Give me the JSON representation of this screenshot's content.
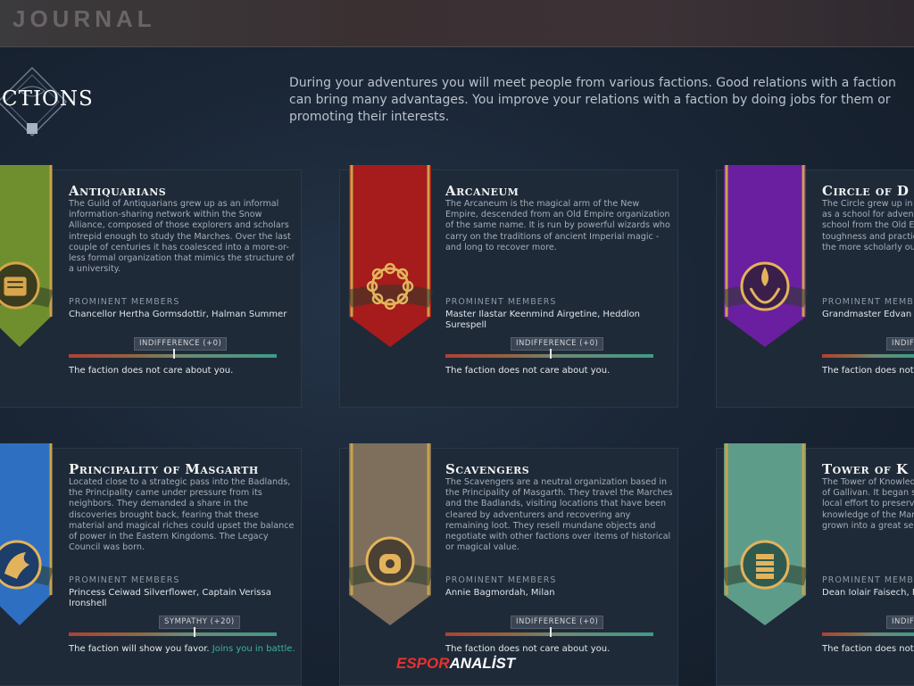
{
  "header": {
    "title": "JOURNAL"
  },
  "section": {
    "title": "FACTIONS",
    "title_visible": "CTIONS",
    "intro": "During your adventures you will meet people from various factions. Good relations with a faction can bring many advantages. You improve your relations with a faction by doing jobs for them or promoting their interests."
  },
  "labels": {
    "prominent_members": "PROMINENT MEMBERS"
  },
  "factions": [
    {
      "name": "Antiquarians",
      "description": "The Guild of Antiquarians grew up as an informal information-sharing network within the Snow Alliance, composed of those explorers and scholars intrepid enough to study the Marches. Over the last couple of centuries it has coalesced into a more-or-less formal organization that mimics the structure of a university.",
      "members": "Chancellor Hertha Gormsdottir, Halman Summer",
      "relation": "INDIFFERENCE (+0)",
      "relation_level": 0.5,
      "status": "The faction does not care about you.",
      "status_extra": "",
      "banner_color": "#6f8f2e",
      "icon": "scroll-quill-icon"
    },
    {
      "name": "Arcaneum",
      "description": "The Arcaneum is the magical arm of the New Empire, descended from an Old Empire organization of the same name. It is run by powerful wizards who carry on the traditions of ancient Imperial magic - and long to recover more.",
      "members": "Master Ilastar Keenmind Airgetine, Heddlon Surespell",
      "relation": "INDIFFERENCE (+0)",
      "relation_level": 0.5,
      "status": "The faction does not care about you.",
      "status_extra": "",
      "banner_color": "#a61b1b",
      "icon": "arcane-ring-icon"
    },
    {
      "name": "Circle of D",
      "description": "The Circle grew up in t as a school for advent school from the Old E toughness and practic the more scholarly ou",
      "members": "Grandmaster Edvan D",
      "relation": "INDIFF",
      "relation_level": 0.5,
      "status": "The faction does not c",
      "status_extra": "",
      "banner_color": "#6a1fa0",
      "icon": "flame-hands-icon"
    },
    {
      "name": "Principality of Masgarth",
      "description": "Located close to a strategic pass into the Badlands, the Principality came under pressure from its neighbors. They demanded a share in the discoveries brought back, fearing that these material and magical riches could upset the balance of power in the Eastern Kingdoms. The Legacy Council was born.",
      "members": "Princess Ceiwad Silverflower, Captain Verissa Ironshell",
      "relation": "SYMPATHY (+20)",
      "relation_level": 0.6,
      "status": "The faction will show you favor.",
      "status_extra": "Joins you in battle.",
      "banner_color": "#2f6fc2",
      "icon": "griffin-icon"
    },
    {
      "name": "Scavengers",
      "description": "The Scavengers are a neutral organization based in the Principality of Masgarth. They travel the Marches and the Badlands, visiting locations that have been cleared by adventurers and recovering any remaining loot. They resell mundane objects and negotiate with other factions over items of historical or magical value.",
      "members": "Annie Bagmordah, Milan",
      "relation": "INDIFFERENCE (+0)",
      "relation_level": 0.5,
      "status": "The faction does not care about you.",
      "status_extra": "",
      "banner_color": "#7d6f5c",
      "icon": "pouch-shovel-icon"
    },
    {
      "name": "Tower of K",
      "description": "The Tower of Knowled of Gallivan. It began s local effort to preserv knowledge of the Man grown into a great sea",
      "members": "Dean Iolair Faisech, M",
      "relation": "INDIFF",
      "relation_level": 0.5,
      "status": "The faction does not c",
      "status_extra": "",
      "banner_color": "#5e9c8a",
      "icon": "tower-books-icon"
    }
  ],
  "watermark": {
    "part1": "ESPOR",
    "part2": "ANALİST"
  }
}
